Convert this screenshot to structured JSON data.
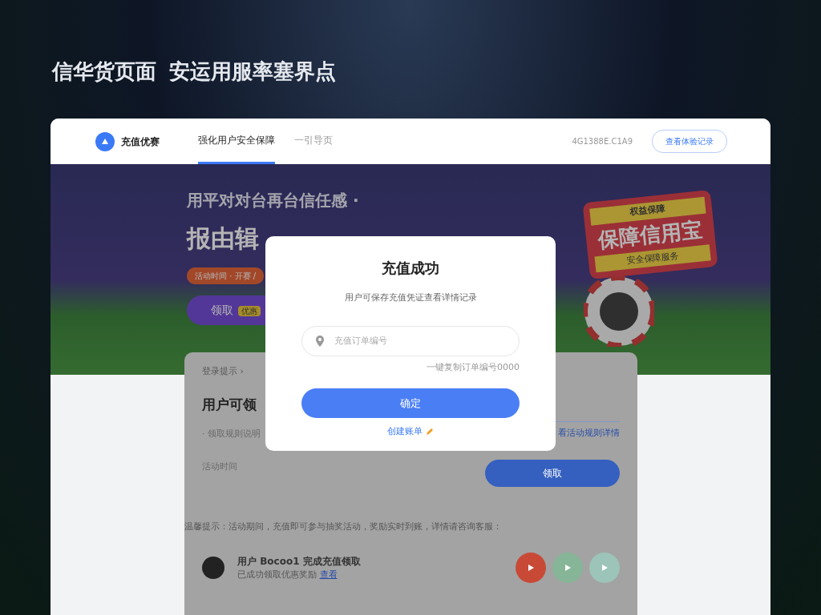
{
  "page_heading": [
    "信华货页面",
    "安运用服率塞界点"
  ],
  "navbar": {
    "logo": "充值优赛",
    "tabs": [
      {
        "label": "强化用户安全保障",
        "selected": true
      },
      {
        "label": "一引导页",
        "selected": false
      }
    ],
    "account": "4G1388E.C1A9",
    "button": "查看体验记录"
  },
  "banner": {
    "subtitle": "用平对对台再台信任感 ·",
    "title": "报由辑",
    "tag": "活动时间 · 开赛 /",
    "button": "领取",
    "button_badge": "优惠",
    "promo_top": "权益保障",
    "promo_title": "保障信用宝",
    "promo_bottom": "安全保障服务"
  },
  "card": {
    "breadcrumb": "登录提示 ›",
    "title": "用户可领",
    "rule": "· 领取规则说明",
    "time": "活动时间",
    "link": "看活动规则详情",
    "button": "领取",
    "notice": "温馨提示：活动期间，充值即可参与抽奖活动，奖励实时到账，详情请咨询客服：",
    "user_title": "用户 Bocoo1 完成充值领取",
    "user_text": "已成功领取优惠奖励",
    "user_link": "查看",
    "actions": [
      {
        "color": "#c84a36"
      },
      {
        "color": "#86b597"
      },
      {
        "color": "#9cc4b9"
      }
    ]
  },
  "modal": {
    "title": "充值成功",
    "subtitle": "用户可保存充值凭证查看详情记录",
    "placeholder": "充值订单编号",
    "hint": "一键复制订单编号0000",
    "button": "确定",
    "link": "创建账单"
  }
}
